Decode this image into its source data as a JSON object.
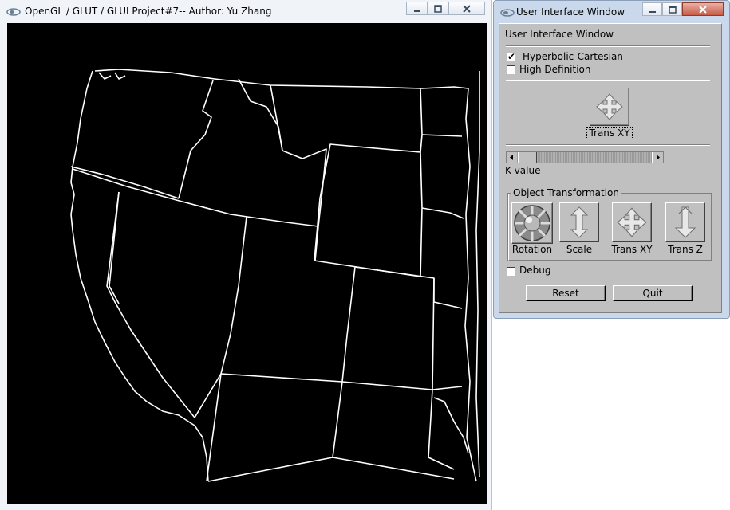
{
  "main_window": {
    "title": "OpenGL / GLUT / GLUI Project#7-- Author: Yu Zhang"
  },
  "ui_window": {
    "title": "User Interface Window",
    "panel_title": "User Interface Window",
    "hyperbolic_checkbox": {
      "label": "Hyperbolic-Cartesian",
      "checked": true
    },
    "high_def_checkbox": {
      "label": "High Definition",
      "checked": false
    },
    "trans_xy_top_label": "Trans XY",
    "slider_label": "K value",
    "slider_value": 0.0,
    "object_transformation": {
      "title": "Object Transformation",
      "rotation_label": "Rotation",
      "scale_label": "Scale",
      "trans_xy_label": "Trans XY",
      "trans_z_label": "Trans Z"
    },
    "debug_checkbox": {
      "label": "Debug",
      "checked": false
    },
    "reset_label": "Reset",
    "quit_label": "Quit"
  },
  "colors": {
    "canvas_background": "#000000",
    "map_lines": "#ffffff",
    "glui_panel": "#c0c0c0",
    "window_frame": "#c9d8ea"
  },
  "icons": {
    "app": "opengl-app-icon",
    "minimize": "minimize-icon",
    "maximize": "maximize-icon",
    "close": "close-icon"
  }
}
